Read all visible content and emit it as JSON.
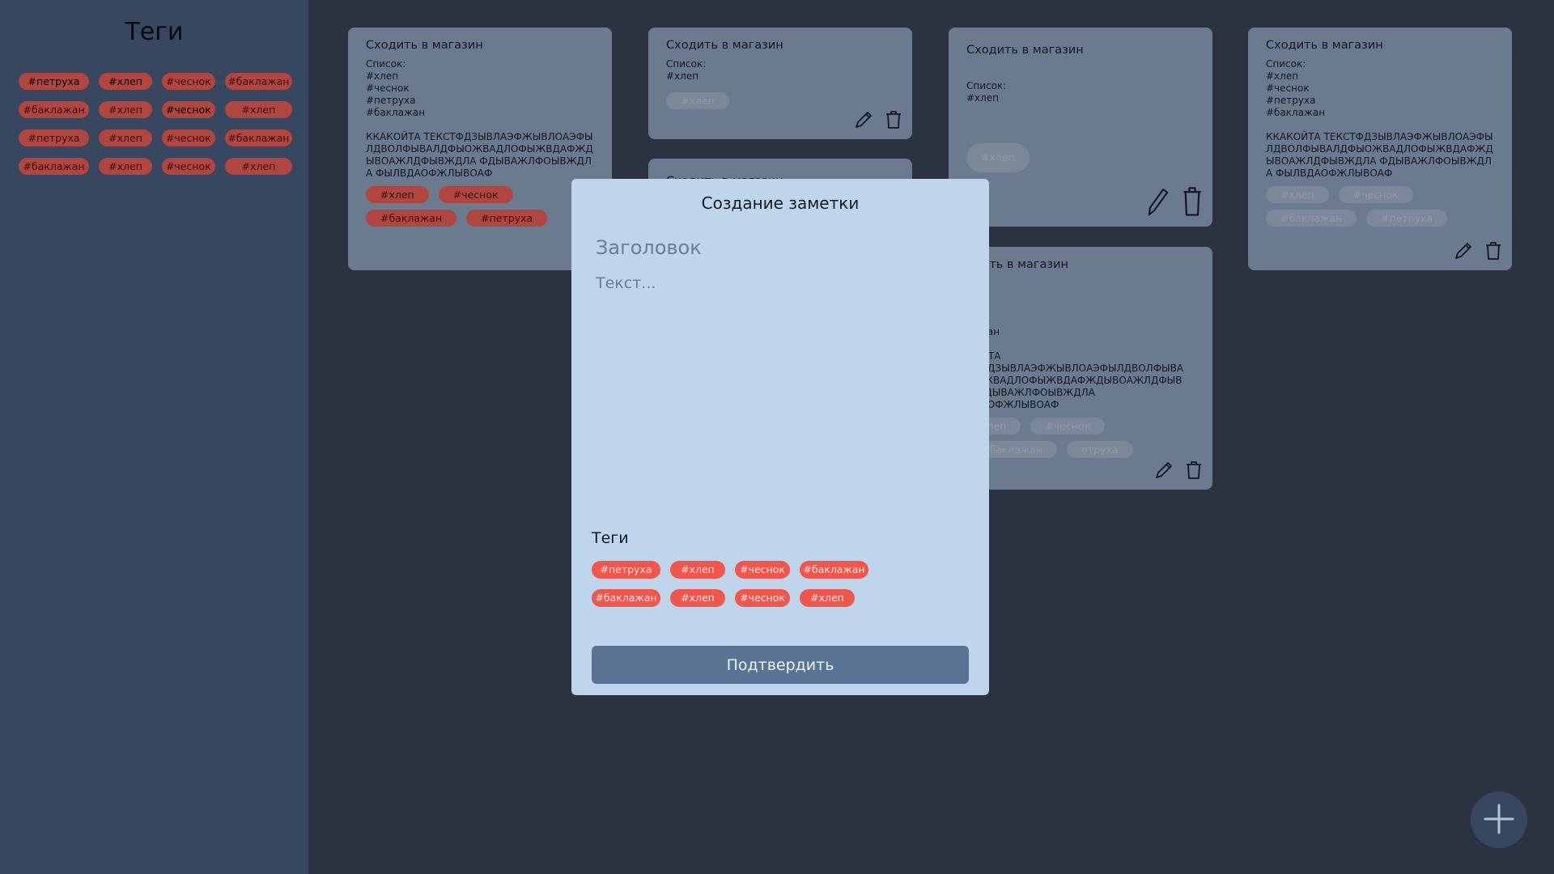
{
  "sidebar": {
    "title": "Теги",
    "tags": [
      [
        "#петруха",
        "#хлеп",
        "#чеснок",
        "#баклажан"
      ],
      [
        "#баклажан",
        "#хлеп",
        "#чеснок",
        "#хлеп"
      ],
      [
        "#петруха",
        "#хлеп",
        "#чеснок",
        "#баклажан"
      ],
      [
        "#баклажан",
        "#хлеп",
        "#чеснок",
        "#хлеп"
      ]
    ]
  },
  "notes": [
    {
      "title": "Сходить в магазин",
      "body": "Список:\n#хлеп\n#чеснок\n#петруха\n#баклажан\n\nККАКОЙТА ТЕКСТФДЗЫВЛАЭФЖЫВЛОАЭФЫЛДВОЛФЫВАЛДФЫОЖВАДЛОФЫЖВДАФЖДЫВОАЖЛДФЫВЖДЛА ФДЫВАЖЛФОЫВЖДЛА ФЫЛВДАОФЖЛЫВОАФ",
      "tags": [
        "#хлеп",
        "#чеснок",
        "#баклажан",
        "#петруха"
      ]
    },
    {
      "title": "Сходить в магазин",
      "body": "Список:\n#хлеп",
      "tags": [
        "#хлеп"
      ]
    },
    {
      "title": "Сходить в магазин",
      "body": "\nСписок:\n#хлеп",
      "tags": [
        "#хлеп"
      ]
    },
    {
      "title": "Сходить в магазин",
      "body": "Список:\n#хлеп\n#чеснок\n#петруха\n#баклажан\n\nККАКОЙТА ТЕКСТФДЗЫВЛАЭФЖЫВЛОАЭФЫЛДВОЛФЫВАЛДФЫОЖВАДЛОФЫЖВДАФЖДЫВОАЖЛДФЫВЖДЛА ФДЫВАЖЛФОЫВЖДЛА ФЫЛВДАОФЖЛЫВОАФ",
      "tags": [
        "#хлеп",
        "#чеснок",
        "#баклажан",
        "#петруха"
      ]
    },
    {
      "title": "Сходить в магазин",
      "body": "",
      "tags": []
    },
    {
      "title": "одить в магазин",
      "body": "сок:\nп\nнок\nруха\nлажан\n\nКОЙТА\nСТФДЗЫВЛАЭФЖЫВЛОАЭФЫЛДВОЛФЫВА\nЫОЖВАДЛОФЫЖВДАФЖДЫВОАЖЛДФЫВ\nА ФДЫВАЖЛФОЫВЖДЛА\nВДАОФЖЛЫВОАФ",
      "tags": [
        "хлеп",
        "#чеснок",
        "#баклажан",
        "етруха"
      ]
    }
  ],
  "modal": {
    "title": "Создание заметки",
    "heading_placeholder": "Заголовок",
    "text_placeholder": "Текст...",
    "tags_title": "Теги",
    "tags": [
      [
        "#петруха",
        "#хлеп",
        "#чеснок",
        "#баклажан"
      ],
      [
        "#баклажан",
        "#хлеп",
        "#чеснок",
        "#хлеп"
      ]
    ],
    "confirm_label": "Подтвердить"
  },
  "colors": {
    "background": "#2b3340",
    "sidebar": "#36475f",
    "note_card": "#6a7b8f",
    "modal": "#bfd5eb",
    "tag_active": "#f0564c",
    "tag_dimmed": "#b1453f",
    "button": "#587394"
  },
  "icons": {
    "edit": "pencil-icon",
    "delete": "trash-icon",
    "add": "plus-icon"
  }
}
